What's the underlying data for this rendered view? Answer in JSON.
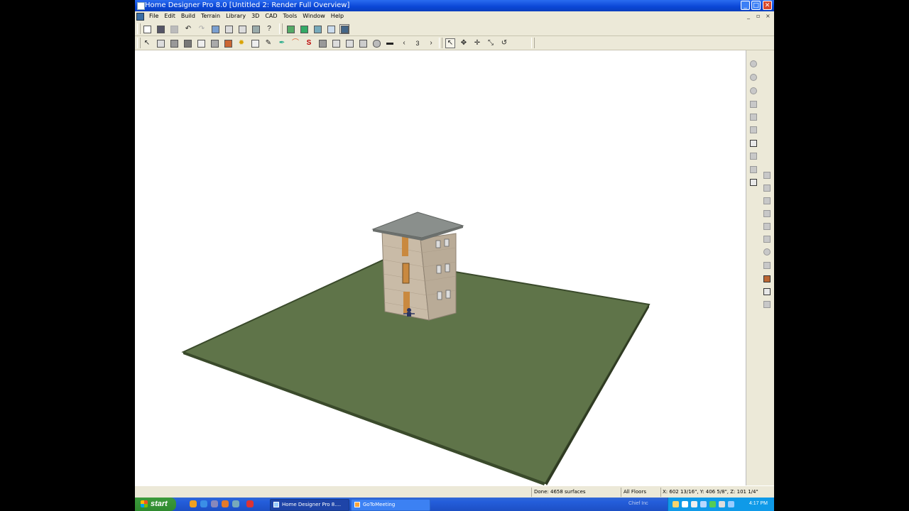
{
  "window": {
    "title": "Home Designer Pro 8.0  [Untitled 2: Render Full Overview]",
    "buttons": {
      "minimize": "_",
      "maximize": "□",
      "close": "✕"
    }
  },
  "menu": {
    "items": [
      "File",
      "Edit",
      "Build",
      "Terrain",
      "Library",
      "3D",
      "CAD",
      "Tools",
      "Window",
      "Help"
    ],
    "mdi_controls": {
      "minimize": "_",
      "restore": "▫",
      "close": "×"
    }
  },
  "toolbar_row2": {
    "floor_prev": "‹",
    "floor_number": "3",
    "floor_next": "›"
  },
  "status": {
    "done": "Done: 4658 surfaces",
    "floors": "All Floors",
    "coords": "X: 602 13/16\", Y: 406 5/8\", Z: 101 1/4\""
  },
  "taskbar": {
    "start": "start",
    "tasks": [
      "Home Designer Pro 8....",
      "GoToMeeting"
    ],
    "tray_label": "Chief Inc",
    "clock": "4:17 PM"
  },
  "colors": {
    "titlebar": "#0a46d6",
    "ground": "#5f7449",
    "ground_edge": "#3a4a2b",
    "wall": "#c9bba7",
    "roof": "#8a8f8c",
    "door": "#c9893f"
  }
}
